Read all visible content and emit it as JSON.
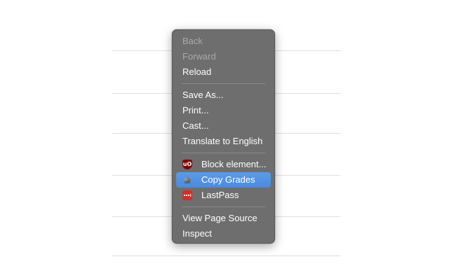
{
  "menu": {
    "back": "Back",
    "forward": "Forward",
    "reload": "Reload",
    "save_as": "Save As...",
    "print": "Print...",
    "cast": "Cast...",
    "translate": "Translate to English",
    "block_element": "Block element...",
    "copy_grades": "Copy Grades",
    "lastpass": "LastPass",
    "view_source": "View Page Source",
    "inspect": "Inspect"
  },
  "icons": {
    "block_element": "ublock-origin-icon",
    "copy_grades": "copy-grades-extension-icon",
    "lastpass": "lastpass-icon"
  },
  "colors": {
    "menu_background": "#6e6e6e",
    "highlight": "#4a90e2",
    "ublock": "#800000",
    "lastpass": "#d32d27"
  }
}
